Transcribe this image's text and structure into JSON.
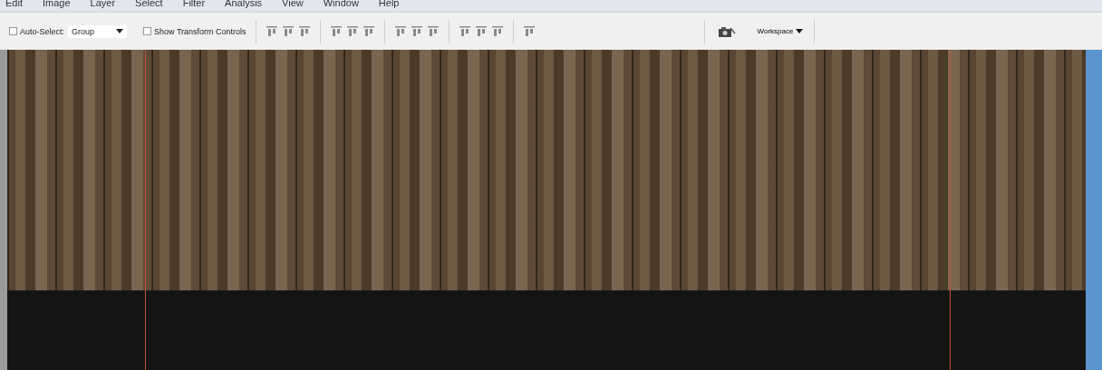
{
  "menu_bar": {
    "items": [
      "Edit",
      "Image",
      "Layer",
      "Select",
      "Filter",
      "Analysis",
      "View",
      "Window",
      "Help"
    ]
  },
  "options_bar": {
    "auto_select": {
      "label": "Auto-Select:",
      "checked": false
    },
    "target_dropdown": {
      "value": "Group"
    },
    "transform_controls": {
      "label": "Show Transform Controls",
      "checked": false
    },
    "workspace": {
      "label": "Workspace"
    }
  }
}
